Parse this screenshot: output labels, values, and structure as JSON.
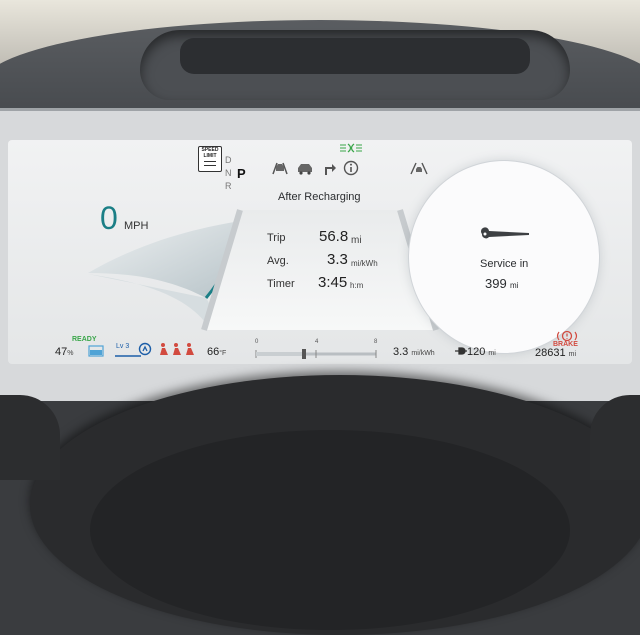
{
  "gear": {
    "items": [
      "D",
      "N",
      "R"
    ],
    "active": "P"
  },
  "speed_limit_sign": {
    "line1": "SPEED",
    "line2": "LIMIT"
  },
  "speed": {
    "value": "0",
    "unit": "MPH"
  },
  "trip_panel": {
    "title": "After Recharging",
    "rows": [
      {
        "label": "Trip",
        "value": "56.8",
        "unit": "mi"
      },
      {
        "label": "Avg.",
        "value": "3.3",
        "unit": "mi/kWh"
      },
      {
        "label": "Timer",
        "value": "3:45",
        "unit": "h:m"
      }
    ]
  },
  "service": {
    "label": "Service in",
    "value": "399",
    "unit": "mi",
    "icon": "wrench-icon"
  },
  "status_bar": {
    "ready": "READY",
    "battery_pct": "47",
    "battery_pct_unit": "%",
    "regen_level": "Lv 3",
    "temperature": "66",
    "temperature_unit": "°F",
    "efficiency_scale": [
      "0",
      "4",
      "8"
    ],
    "efficiency_level": 0.4,
    "efficiency": "3.3",
    "efficiency_unit": "mi/kWh",
    "range": "120",
    "range_unit": "mi",
    "brake": "BRAKE",
    "odometer": "28631",
    "odometer_unit": "mi"
  },
  "colors": {
    "accent": "#1b7f86",
    "ready": "#3aa64a",
    "warning": "#d24a3f",
    "battery": "#4fa3d6"
  }
}
